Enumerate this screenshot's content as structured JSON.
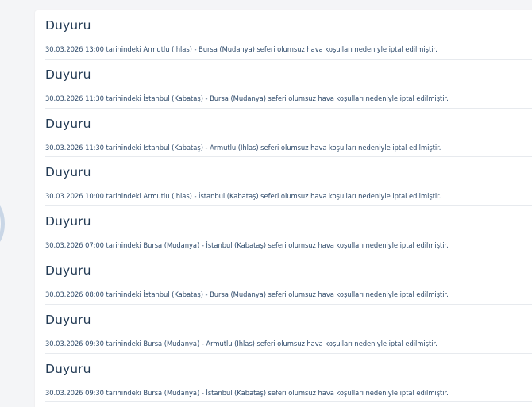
{
  "announcements": [
    {
      "title": "Duyuru",
      "text": "30.03.2026 13:00 tarihindeki Armutlu (İhlas) - Bursa (Mudanya) seferi olumsuz hava koşulları nedeniyle iptal edilmiştir."
    },
    {
      "title": "Duyuru",
      "text": "30.03.2026 11:30 tarihindeki İstanbul (Kabataş) - Bursa (Mudanya) seferi olumsuz hava koşulları nedeniyle iptal edilmiştir."
    },
    {
      "title": "Duyuru",
      "text": "30.03.2026 11:30 tarihindeki İstanbul (Kabataş) - Armutlu (İhlas) seferi olumsuz hava koşulları nedeniyle iptal edilmiştir."
    },
    {
      "title": "Duyuru",
      "text": "30.03.2026 10:00 tarihindeki Armutlu (İhlas) - İstanbul (Kabataş) seferi olumsuz hava koşulları nedeniyle iptal edilmiştir."
    },
    {
      "title": "Duyuru",
      "text": "30.03.2026 07:00 tarihindeki Bursa (Mudanya) - İstanbul (Kabataş) seferi olumsuz hava koşulları nedeniyle iptal edilmiştir."
    },
    {
      "title": "Duyuru",
      "text": "30.03.2026 08:00 tarihindeki İstanbul (Kabataş) - Bursa (Mudanya) seferi olumsuz hava koşulları nedeniyle iptal edilmiştir."
    },
    {
      "title": "Duyuru",
      "text": "30.03.2026 09:30 tarihindeki Bursa (Mudanya) - Armutlu (İhlas) seferi olumsuz hava koşulları nedeniyle iptal edilmiştir."
    },
    {
      "title": "Duyuru",
      "text": "30.03.2026 09:30 tarihindeki Bursa (Mudanya) - İstanbul (Kabataş) seferi olumsuz hava koşulları nedeniyle iptal edilmiştir."
    }
  ]
}
